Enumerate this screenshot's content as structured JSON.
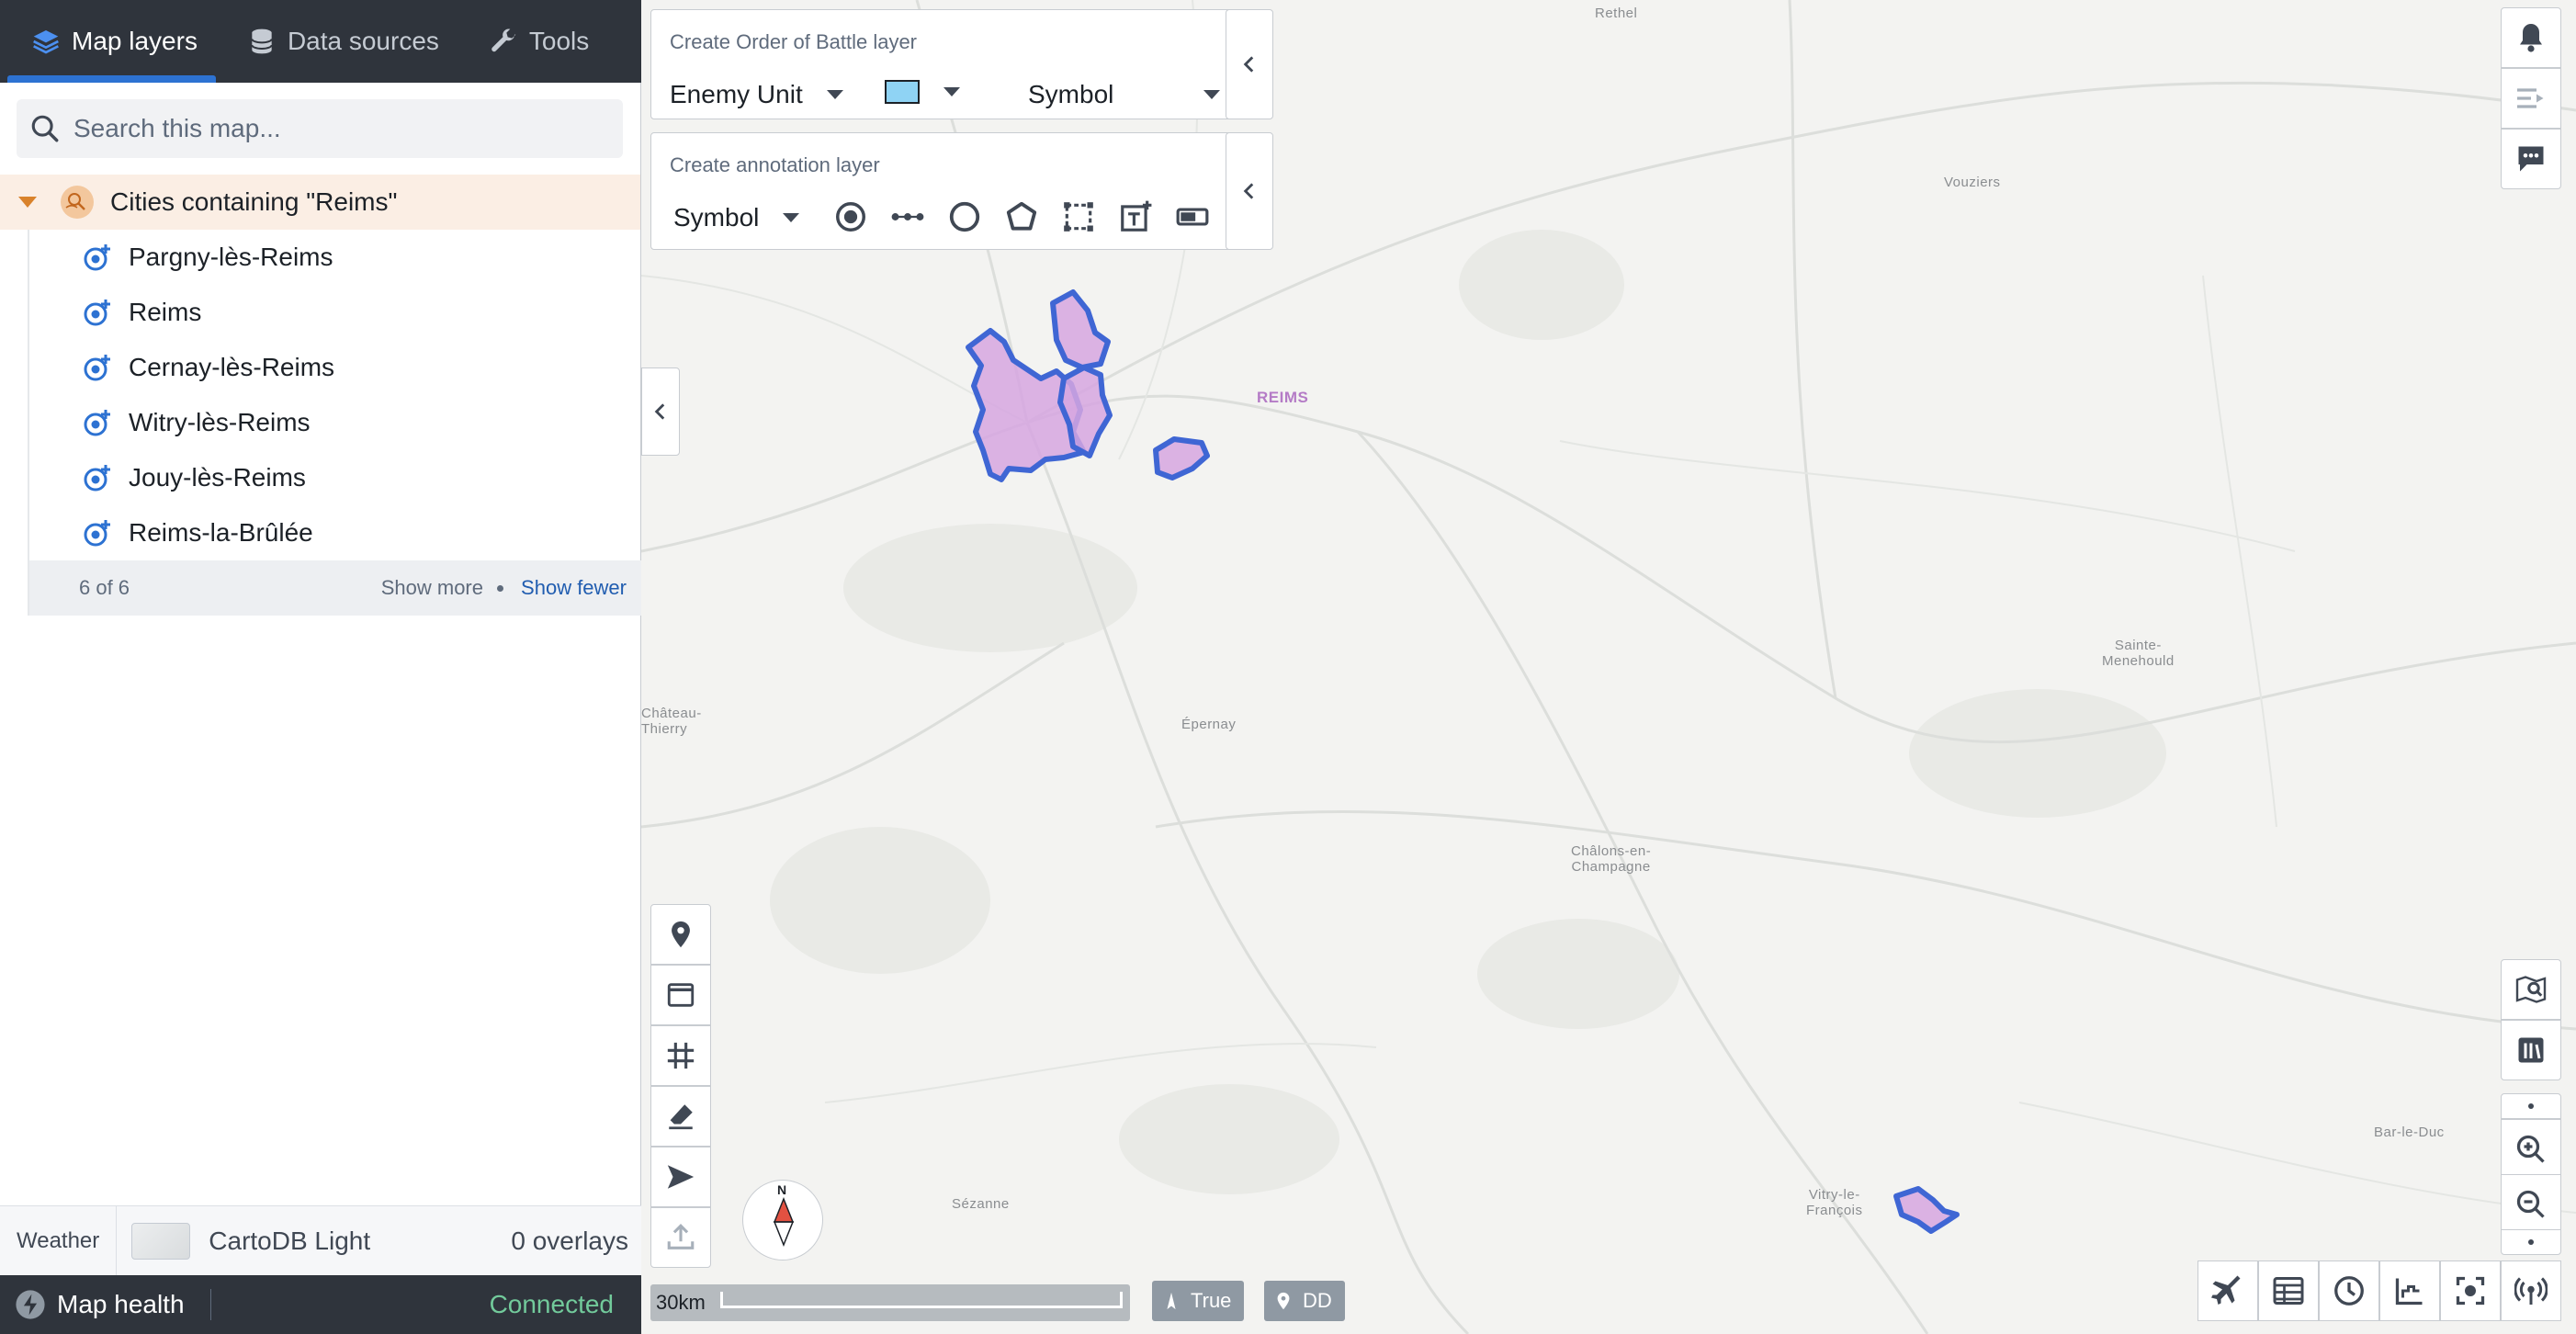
{
  "left_panel": {
    "tabs": [
      {
        "label": "Map layers",
        "icon": "layers-icon",
        "active": true
      },
      {
        "label": "Data sources",
        "icon": "database-icon",
        "active": false
      },
      {
        "label": "Tools",
        "icon": "wrench-icon",
        "active": false
      }
    ],
    "search": {
      "placeholder": "Search this map..."
    },
    "layer_group": {
      "title": "Cities containing \"Reims\"",
      "items": [
        {
          "label": "Pargny-lès-Reims"
        },
        {
          "label": "Reims"
        },
        {
          "label": "Cernay-lès-Reims"
        },
        {
          "label": "Witry-lès-Reims"
        },
        {
          "label": "Jouy-lès-Reims"
        },
        {
          "label": "Reims-la-Brûlée"
        }
      ],
      "count_label": "6 of 6",
      "show_more": "Show more",
      "show_fewer": "Show fewer"
    },
    "basemap": {
      "weather": "Weather",
      "name": "CartoDB Light",
      "overlays": "0 overlays"
    },
    "health": {
      "label": "Map health",
      "status": "Connected"
    }
  },
  "toolbar": {
    "order_of_battle": {
      "title": "Create Order of Battle layer",
      "unit": "Enemy Unit",
      "style": "Symbol",
      "swatch_color": "#8fd3f4"
    },
    "annotation": {
      "title": "Create annotation layer",
      "style": "Symbol",
      "tools": [
        "point-tool-icon",
        "line-tool-icon",
        "circle-tool-icon",
        "polygon-tool-icon",
        "rectangle-tool-icon",
        "text-tool-icon",
        "label-tool-icon"
      ]
    }
  },
  "map": {
    "labels": {
      "rethel": "Rethel",
      "vouziers": "Vouziers",
      "reims": "REIMS",
      "sainte_menehould": "Sainte-\nMenehould",
      "chateau_thierry": "Château-\nThierry",
      "epernay": "Épernay",
      "chalons": "Châlons-en-\nChampagne",
      "sezanne": "Sézanne",
      "vitry": "Vitry-le-\nFrançois",
      "bar_le_duc": "Bar-le-Duc"
    },
    "scale": "30km",
    "north": "N",
    "pills": {
      "true_north": "True",
      "coord_format": "DD"
    },
    "highlight_fill": "#d6a6e0",
    "highlight_stroke": "#3f66d4"
  }
}
